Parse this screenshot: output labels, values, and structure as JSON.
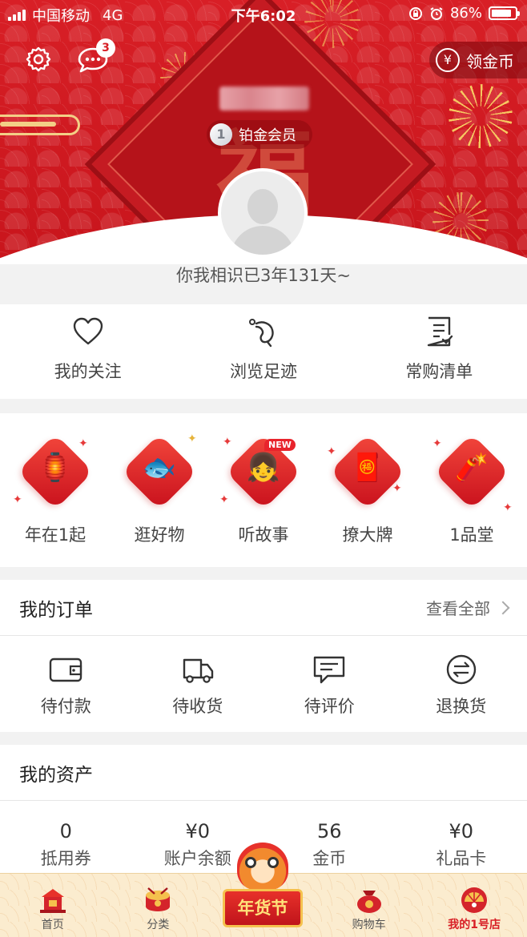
{
  "status_bar": {
    "carrier": "中国移动",
    "network": "4G",
    "time": "下午6:02",
    "battery": "86%",
    "battery_level": 0.86
  },
  "header": {
    "message_count": "3",
    "coin_button_label": "领金币",
    "coin_symbol": "¥",
    "hero_character": "福",
    "member_level_number": "1",
    "member_level": "铂金会员"
  },
  "profile": {
    "acquaintance_text": "你我相识已3年131天~"
  },
  "quick_links": [
    {
      "label": "我的关注",
      "icon": "heart-icon"
    },
    {
      "label": "浏览足迹",
      "icon": "footprint-icon"
    },
    {
      "label": "常购清单",
      "icon": "checklist-icon"
    }
  ],
  "activities": [
    {
      "label": "年在1起",
      "icon": "lantern-icon",
      "glyph": "🏮"
    },
    {
      "label": "逛好物",
      "icon": "koi-fish-icon",
      "glyph": "🐟"
    },
    {
      "label": "听故事",
      "icon": "girl-face-icon",
      "glyph": "👧",
      "tag": "NEW"
    },
    {
      "label": "撩大牌",
      "icon": "chinese-knot-icon",
      "glyph": "🧧"
    },
    {
      "label": "1品堂",
      "icon": "firecracker-icon",
      "glyph": "🧨"
    }
  ],
  "orders": {
    "title": "我的订单",
    "see_all": "查看全部",
    "items": [
      {
        "label": "待付款",
        "icon": "wallet-icon"
      },
      {
        "label": "待收货",
        "icon": "truck-icon"
      },
      {
        "label": "待评价",
        "icon": "comment-icon"
      },
      {
        "label": "退换货",
        "icon": "exchange-icon"
      }
    ]
  },
  "assets": {
    "title": "我的资产",
    "items": [
      {
        "value": "0",
        "label": "抵用券"
      },
      {
        "value": "¥0",
        "label": "账户余额"
      },
      {
        "value": "56",
        "label": "金币"
      },
      {
        "value": "¥0",
        "label": "礼品卡"
      }
    ]
  },
  "tabbar": {
    "items": [
      {
        "label": "首页",
        "icon": "home-house-icon"
      },
      {
        "label": "分类",
        "icon": "drum-icon"
      },
      {
        "label": "",
        "icon": "lion-dance-icon"
      },
      {
        "label": "购物车",
        "icon": "money-bag-cart-icon"
      },
      {
        "label": "我的1号店",
        "icon": "profile-fan-icon",
        "active": true
      }
    ],
    "festival_label": "年货节"
  },
  "colors": {
    "brand_red": "#d81f26",
    "gold": "#f3cf86",
    "tabbar_bg": "#fbeccf"
  }
}
